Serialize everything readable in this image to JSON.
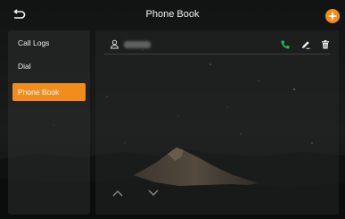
{
  "window": {
    "title": "Phone Book"
  },
  "toolbar": {
    "back_icon": "back-arrow-icon",
    "add_icon": "plus-icon"
  },
  "sidebar": {
    "items": [
      {
        "label": "Call Logs",
        "active": false
      },
      {
        "label": "Dial",
        "active": false
      },
      {
        "label": "Phone Book",
        "active": true
      }
    ]
  },
  "contacts": [
    {
      "name": "",
      "icons": [
        "contact-icon",
        "phone-icon",
        "edit-icon",
        "delete-icon"
      ]
    }
  ],
  "pager": {
    "up_icon": "chevron-up-icon",
    "down_icon": "chevron-down-icon"
  },
  "colors": {
    "accent": "#f28c1b",
    "call_green": "#2fb34a",
    "background": "#151616"
  }
}
